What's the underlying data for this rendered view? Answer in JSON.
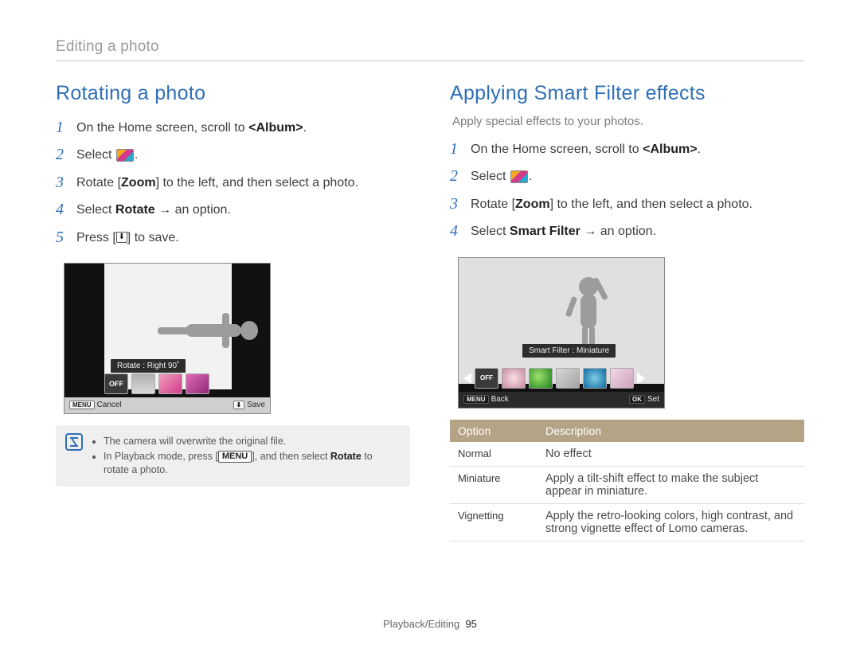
{
  "breadcrumb": "Editing a photo",
  "left": {
    "heading": "Rotating a photo",
    "steps": {
      "s1_a": "On the Home screen, scroll to ",
      "s1_b": "<Album>",
      "s1_c": ".",
      "s2_a": "Select ",
      "s2_c": ".",
      "s3_a": "Rotate [",
      "s3_b": "Zoom",
      "s3_c": "] to the left, and then select a photo.",
      "s4_a": "Select ",
      "s4_b": "Rotate",
      "s4_c": " → an option.",
      "s5_a": "Press [",
      "s5_c": "] to save."
    },
    "lcd": {
      "label": "Rotate : Right 90˚",
      "off": "OFF",
      "menu_btn": "MENU",
      "cancel": "Cancel",
      "save_icon": "⬇",
      "save": "Save"
    },
    "note": {
      "line1": "The camera will overwrite the original file.",
      "line2_a": "In Playback mode, press [",
      "line2_btn": "MENU",
      "line2_b": "], and then select ",
      "line2_bold": "Rotate",
      "line2_c": " to rotate a photo."
    }
  },
  "right": {
    "heading": "Applying Smart Filter effects",
    "intro": "Apply special effects to your photos.",
    "steps": {
      "s1_a": "On the Home screen, scroll to ",
      "s1_b": "<Album>",
      "s1_c": ".",
      "s2_a": "Select ",
      "s2_c": ".",
      "s3_a": "Rotate [",
      "s3_b": "Zoom",
      "s3_c": "] to the left, and then select a photo.",
      "s4_a": "Select ",
      "s4_b": "Smart Filter",
      "s4_c": " → an option."
    },
    "lcd": {
      "label": "Smart Filter : Miniature",
      "off": "OFF",
      "menu_btn": "MENU",
      "back": "Back",
      "ok_btn": "OK",
      "set": "Set"
    },
    "table": {
      "h1": "Option",
      "h2": "Description",
      "rows": [
        {
          "opt": "Normal",
          "desc": "No effect"
        },
        {
          "opt": "Miniature",
          "desc": "Apply a tilt-shift effect to make the subject appear in miniature."
        },
        {
          "opt": "Vignetting",
          "desc": "Apply the retro-looking colors, high contrast, and strong vignette effect of Lomo cameras."
        }
      ]
    }
  },
  "footer": {
    "section": "Playback/Editing",
    "page": "95"
  },
  "icons": {
    "edit": "edit-icon",
    "download": "⬇"
  }
}
